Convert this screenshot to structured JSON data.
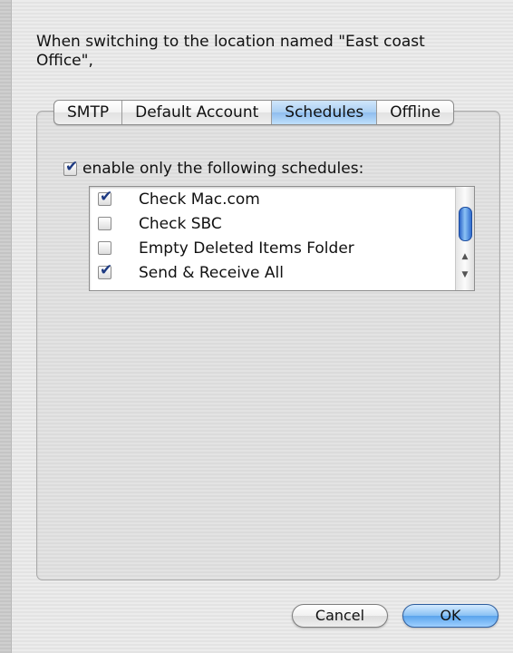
{
  "intro_text": "When switching to the location named \"East coast Office\",",
  "tabs": [
    {
      "label": "SMTP",
      "active": false
    },
    {
      "label": "Default Account",
      "active": false
    },
    {
      "label": "Schedules",
      "active": true
    },
    {
      "label": "Offline",
      "active": false
    }
  ],
  "enable_checkbox": {
    "label": "enable only the following schedules:",
    "checked": true
  },
  "schedules": [
    {
      "label": "Check Mac.com",
      "checked": true
    },
    {
      "label": "Check SBC",
      "checked": false
    },
    {
      "label": "Empty Deleted Items Folder",
      "checked": false
    },
    {
      "label": "Send & Receive All",
      "checked": true
    }
  ],
  "buttons": {
    "cancel": "Cancel",
    "ok": "OK"
  },
  "colors": {
    "accent_blue": "#8fbdee",
    "checkmark": "#1d3a82"
  }
}
